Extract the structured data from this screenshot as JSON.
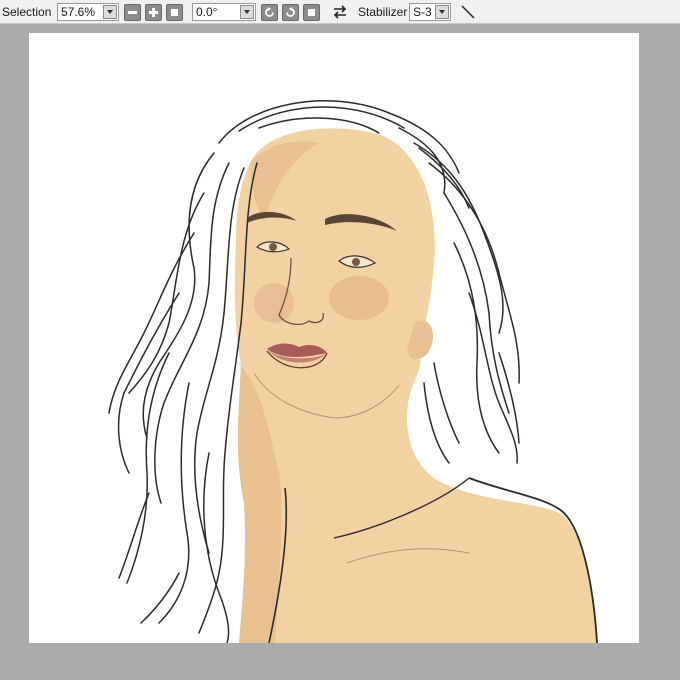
{
  "toolbar": {
    "selection_label": "Selection",
    "zoom_value": "57.6%",
    "angle_value": "0.0°",
    "stabilizer_label": "Stabilizer",
    "stabilizer_value": "S-3"
  },
  "icons": {
    "zoom_dropdown": "chevron-down-icon",
    "zoom_out": "minus-icon",
    "zoom_in": "plus-icon",
    "zoom_reset": "square-icon",
    "angle_dropdown": "chevron-down-icon",
    "rotate_left": "rotate-ccw-icon",
    "rotate_right": "rotate-cw-icon",
    "rotate_reset": "square-icon",
    "flip": "flip-horizontal-icon",
    "stabilizer_dropdown": "chevron-down-icon",
    "pen_line": "diagonal-line-icon"
  },
  "colors": {
    "toolbar_bg": "#f0f0f0",
    "workspace_bg": "#ababab",
    "paper_bg": "#ffffff",
    "button_bg": "#8c8c8c",
    "skin": "#f2d2a2",
    "skin_shadow": "#dca982",
    "lips": "#b8706a",
    "line": "#2e2a28"
  }
}
